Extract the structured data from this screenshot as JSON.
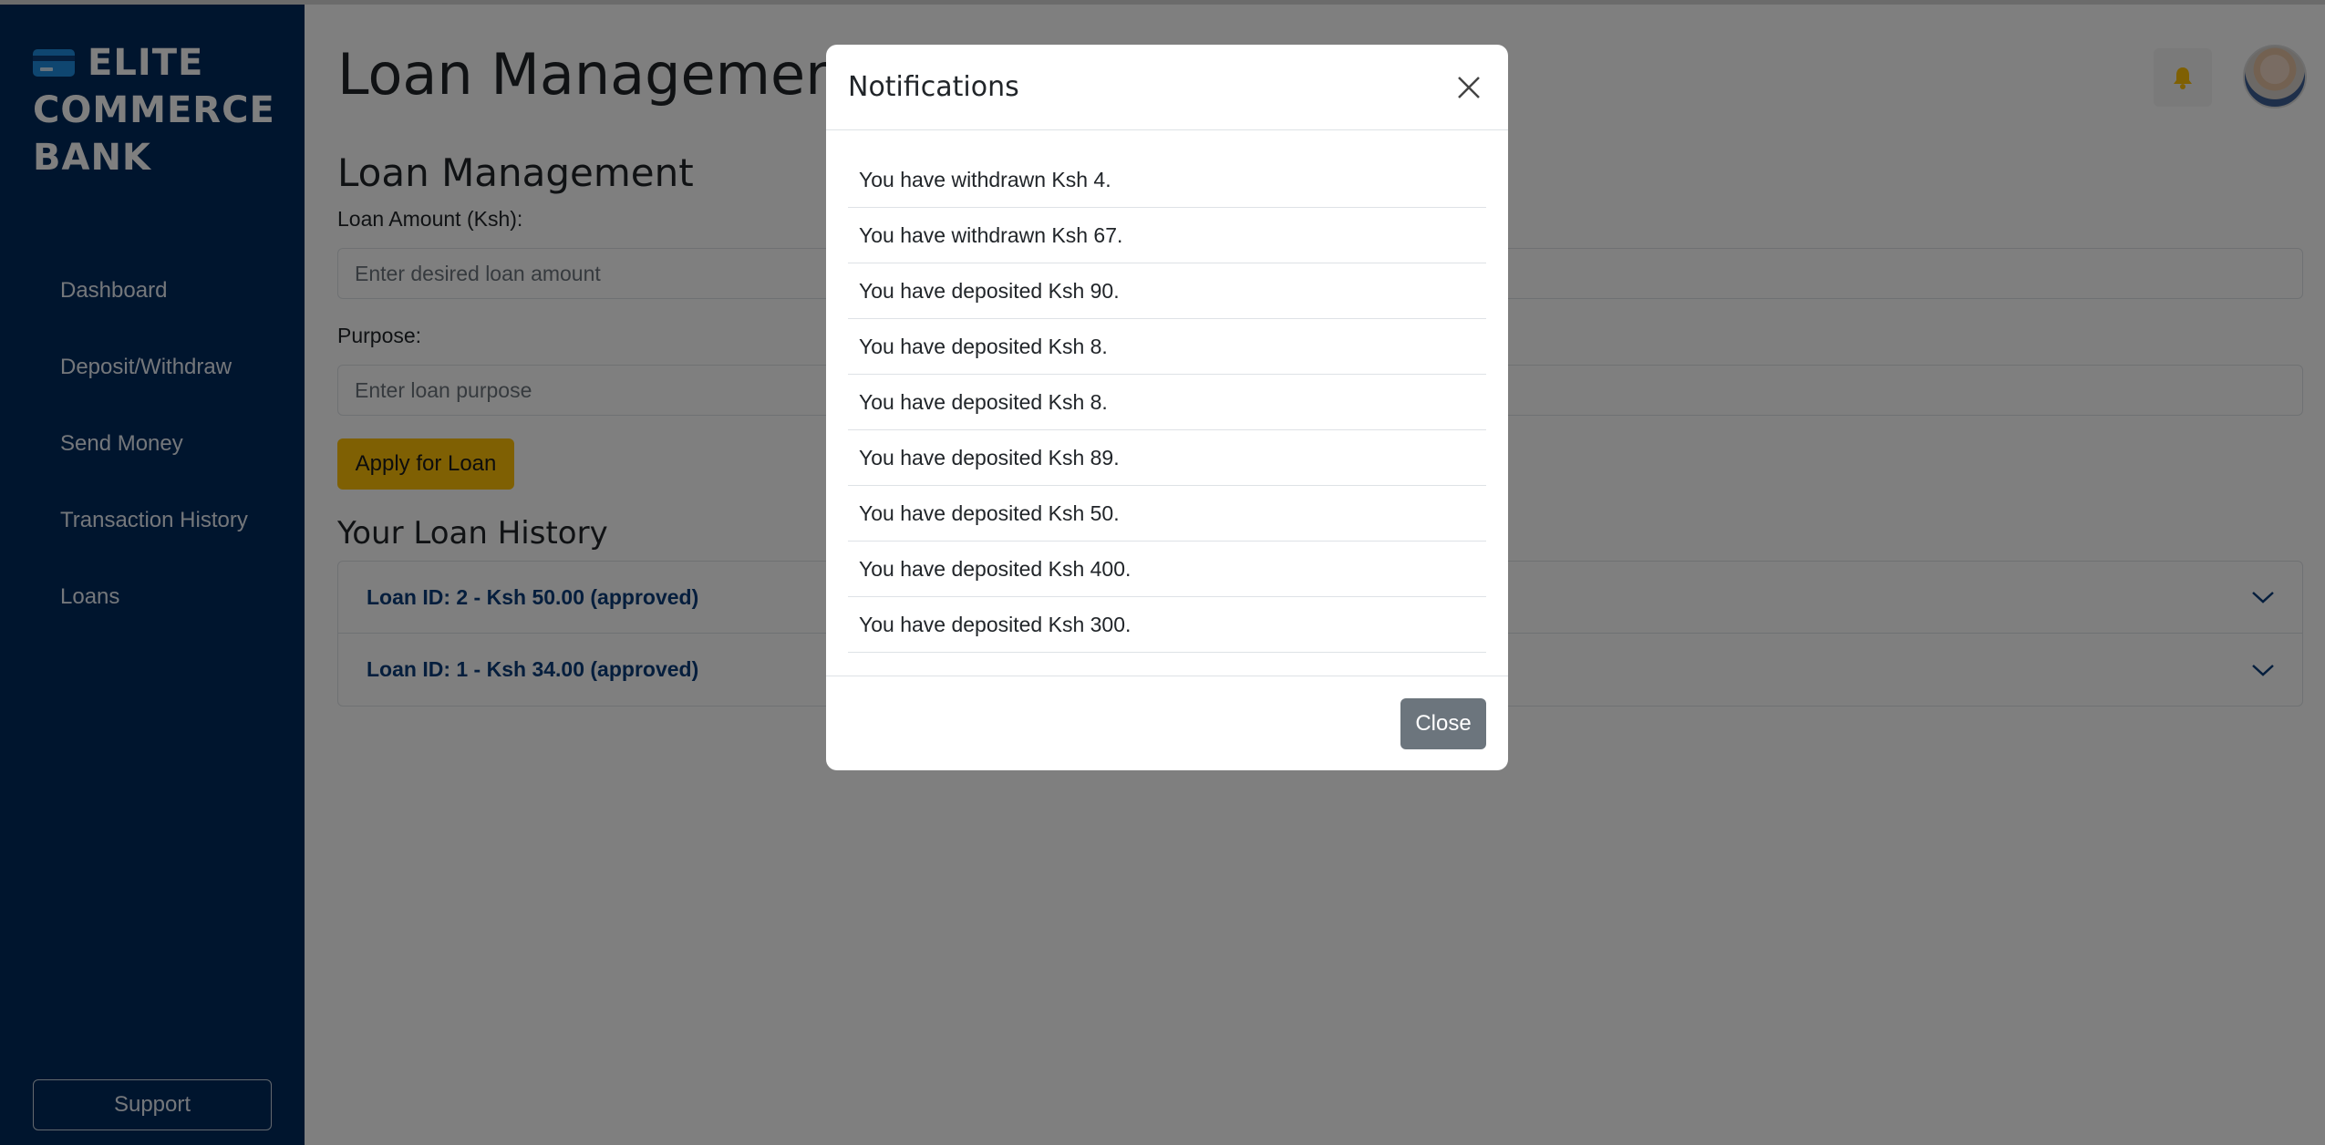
{
  "sidebar": {
    "brand": "ELITE COMMERCE BANK",
    "nav": [
      "Dashboard",
      "Deposit/Withdraw",
      "Send Money",
      "Transaction History",
      "Loans"
    ],
    "support_label": "Support"
  },
  "header": {
    "page_title": "Loan Management",
    "icons": {
      "bell": "bell-icon",
      "avatar": "user-avatar"
    }
  },
  "loan_form": {
    "section_title": "Loan Management",
    "amount_label": "Loan Amount (Ksh):",
    "amount_placeholder": "Enter desired loan amount",
    "purpose_label": "Purpose:",
    "purpose_placeholder": "Enter loan purpose",
    "apply_label": "Apply for Loan"
  },
  "loan_history": {
    "title": "Your Loan History",
    "items": [
      "Loan ID: 2 - Ksh 50.00 (approved)",
      "Loan ID: 1 - Ksh 34.00 (approved)"
    ]
  },
  "notifications_modal": {
    "title": "Notifications",
    "items": [
      "You have withdrawn Ksh 4.",
      "You have withdrawn Ksh 67.",
      "You have deposited Ksh 90.",
      "You have deposited Ksh 8.",
      "You have deposited Ksh 8.",
      "You have deposited Ksh 89.",
      "You have deposited Ksh 50.",
      "You have deposited Ksh 400.",
      "You have deposited Ksh 300."
    ],
    "close_label": "Close"
  },
  "colors": {
    "sidebar_bg": "#002a5c",
    "accent_yellow": "#ffc107",
    "link_blue": "#0b3c7a",
    "secondary_gray": "#6c757d"
  }
}
